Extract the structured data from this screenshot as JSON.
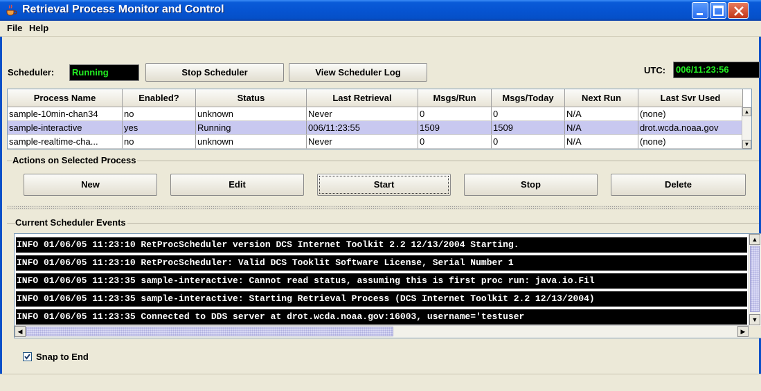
{
  "window": {
    "title": "Retrieval Process Monitor and Control",
    "app_icon": "java-coffee-cup-icon"
  },
  "menu": [
    "File",
    "Help"
  ],
  "scheduler": {
    "label": "Scheduler:",
    "status": "Running",
    "stop_button": "Stop Scheduler",
    "log_button": "View Scheduler Log",
    "utc_label": "UTC:",
    "utc_value": "006/11:23:56"
  },
  "process_table": {
    "columns": [
      "Process Name",
      "Enabled?",
      "Status",
      "Last Retrieval",
      "Msgs/Run",
      "Msgs/Today",
      "Next Run",
      "Last Svr Used"
    ],
    "rows": [
      [
        "sample-10min-chan34",
        "no",
        "unknown",
        "Never",
        "0",
        "0",
        "N/A",
        "(none)"
      ],
      [
        "sample-interactive",
        "yes",
        "Running",
        "006/11:23:55",
        "1509",
        "1509",
        "N/A",
        "drot.wcda.noaa.gov"
      ],
      [
        "sample-realtime-cha...",
        "no",
        "unknown",
        "Never",
        "0",
        "0",
        "N/A",
        "(none)"
      ]
    ],
    "selected_row": 1
  },
  "actions": {
    "title": "Actions on Selected Process",
    "buttons": [
      "New",
      "Edit",
      "Start",
      "Stop",
      "Delete"
    ]
  },
  "events": {
    "title": "Current Scheduler Events",
    "lines": [
      "INFO 01/06/05 11:23:10 RetProcScheduler version DCS Internet Toolkit 2.2 12/13/2004 Starting.",
      "INFO 01/06/05 11:23:10 RetProcScheduler: Valid DCS Tooklit Software License, Serial Number 1",
      "INFO 01/06/05 11:23:35 sample-interactive: Cannot read status, assuming this is first proc run: java.io.Fil",
      "INFO 01/06/05 11:23:35 sample-interactive: Starting Retrieval Process (DCS Internet Toolkit 2.2 12/13/2004)",
      "INFO 01/06/05 11:23:35 Connected to DDS server at drot.wcda.noaa.gov:16003, username='testuser"
    ],
    "snap_label": "Snap to End",
    "snap_checked": true
  },
  "colors": {
    "titlebar": "#0654d2",
    "status_text": "#22ee22",
    "selected_row": "#c8c8f0"
  }
}
